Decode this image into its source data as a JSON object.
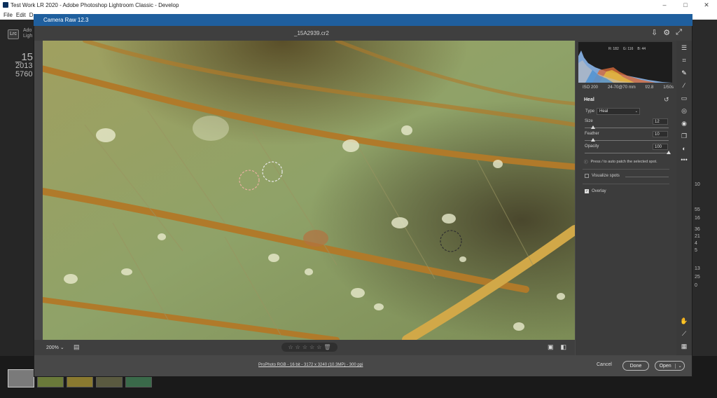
{
  "lightroom": {
    "window_title": "Test Work LR 2020 - Adobe Photoshop Lightroom Classic - Develop",
    "menu": [
      "File",
      "Edit",
      "D"
    ],
    "logo": "Lrc",
    "logo_sub": [
      "Ado",
      "Ligh"
    ],
    "photo_info": [
      "_15",
      "2013",
      "5760"
    ],
    "right_numbers": [
      "10",
      "55",
      "16",
      "36",
      "21",
      "4",
      "5",
      "13",
      "25",
      "0"
    ]
  },
  "camera_raw": {
    "title": "Camera Raw 12.3",
    "filename": "_15A2939.cr2",
    "zoom": "200%",
    "rating_stars": [
      "☆",
      "☆",
      "☆",
      "☆",
      "☆"
    ],
    "workflow": "ProPhoto RGB - 16 bit - 3172 x 3240 (10.3MP) - 300 ppi",
    "cancel": "Cancel",
    "done": "Done",
    "open": "Open"
  },
  "histogram": {
    "r": "R: 182",
    "g": "G: 116",
    "b": "B: 44"
  },
  "camera_info": [
    "ISO 200",
    "24-70@70 mm",
    "f/2.8",
    "1/50s"
  ],
  "heal_panel": {
    "title": "Heal",
    "type_label": "Type",
    "type_value": "Heal",
    "size_label": "Size",
    "size_value": "12",
    "size_fraction": 0.1,
    "feather_label": "Feather",
    "feather_value": "10",
    "feather_fraction": 0.1,
    "opacity_label": "Opacity",
    "opacity_value": "100",
    "opacity_fraction": 1.0,
    "hint": "Press / to auto patch the selected spot.",
    "visualize_label": "Visualize spots",
    "overlay_label": "Overlay",
    "overlay_checked": true,
    "visualize_checked": false
  },
  "tools": [
    "edit-sliders-icon",
    "crop-icon",
    "heal-icon",
    "brush-icon",
    "linear-gradient-icon",
    "radial-gradient-icon",
    "redeye-icon",
    "snapshots-icon",
    "presets-icon",
    "more-icon",
    "hand-icon",
    "color-sampler-icon",
    "grid-icon"
  ]
}
